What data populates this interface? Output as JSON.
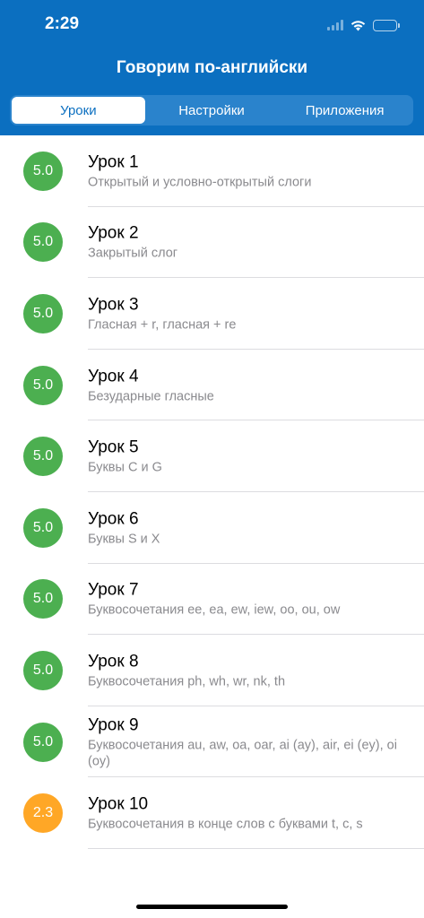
{
  "status_bar": {
    "time": "2:29"
  },
  "nav": {
    "title": "Говорим по-английски"
  },
  "tabs": [
    {
      "label": "Уроки",
      "active": true
    },
    {
      "label": "Настройки",
      "active": false
    },
    {
      "label": "Приложения",
      "active": false
    }
  ],
  "lessons": [
    {
      "title": "Урок 1",
      "subtitle": "Открытый и условно-открытый слоги",
      "score": "5.0",
      "color": "#4caf50"
    },
    {
      "title": "Урок 2",
      "subtitle": "Закрытый слог",
      "score": "5.0",
      "color": "#4caf50"
    },
    {
      "title": "Урок 3",
      "subtitle": "Гласная + r, гласная + re",
      "score": "5.0",
      "color": "#4caf50"
    },
    {
      "title": "Урок 4",
      "subtitle": "Безударные гласные",
      "score": "5.0",
      "color": "#4caf50"
    },
    {
      "title": "Урок 5",
      "subtitle": "Буквы С и G",
      "score": "5.0",
      "color": "#4caf50"
    },
    {
      "title": "Урок 6",
      "subtitle": "Буквы S и X",
      "score": "5.0",
      "color": "#4caf50"
    },
    {
      "title": "Урок 7",
      "subtitle": "Буквосочетания ee, ea, ew, iew, oo, ou, ow",
      "score": "5.0",
      "color": "#4caf50"
    },
    {
      "title": "Урок 8",
      "subtitle": "Буквосочетания ph, wh, wr, nk, th",
      "score": "5.0",
      "color": "#4caf50"
    },
    {
      "title": "Урок 9",
      "subtitle": "Буквосочетания au, aw, oa, oar, ai (ay), air, ei (ey), oi (oy)",
      "score": "5.0",
      "color": "#4caf50"
    },
    {
      "title": "Урок 10",
      "subtitle": "Буквосочетания в конце слов с буквами t, c, s",
      "score": "2.3",
      "color": "#ffa726"
    }
  ]
}
